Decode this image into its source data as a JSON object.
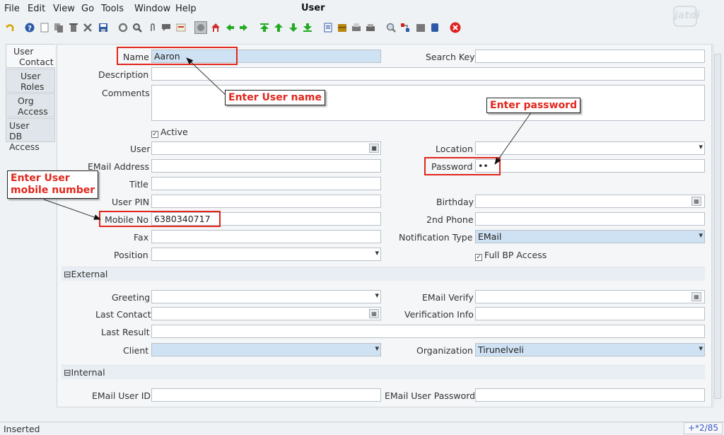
{
  "menu": [
    "File",
    "Edit",
    "View",
    "Go",
    "Tools",
    "Window",
    "Help"
  ],
  "window_title": "User",
  "logo_text": "jatdi",
  "toolbar_icons": [
    "undo-icon",
    "help-icon",
    "new-icon",
    "copy-icon",
    "delete-icon",
    "delete-selection-icon",
    "save-icon",
    "refresh-icon",
    "find-icon",
    "attachment-icon",
    "chat-icon",
    "history-icon",
    "home-icon",
    "parent-icon",
    "detail-icon",
    "first-record-icon",
    "previous-record-icon",
    "next-record-icon",
    "last-record-icon",
    "report-icon",
    "archive-icon",
    "print-preview-icon",
    "print-icon",
    "zoom-across-icon",
    "active-workflows-icon",
    "requests-icon",
    "product-info-icon",
    "close-window-icon"
  ],
  "tabs": [
    {
      "line1": "User",
      "line2": "Contact"
    },
    {
      "line1": "User",
      "line2": "Roles"
    },
    {
      "line1": "Org",
      "line2": "Access"
    },
    {
      "line1": "User",
      "line2": "DB Access"
    }
  ],
  "form": {
    "name_label": "Name",
    "name_value": "Aaron",
    "search_key_label": "Search Key",
    "search_key_value": "",
    "description_label": "Description",
    "description_value": "",
    "comments_label": "Comments",
    "comments_value": "",
    "active_label": "Active",
    "active_checked": true,
    "user_label": "User",
    "user_value": "",
    "location_label": "Location",
    "location_value": "",
    "email_label": "EMail Address",
    "email_value": "",
    "password_label": "Password",
    "password_value": "••",
    "title_label": "Title",
    "title_value": "",
    "user_pin_label": "User PIN",
    "user_pin_value": "",
    "birthday_label": "Birthday",
    "birthday_value": "",
    "mobile_label": "Mobile No",
    "mobile_value": "6380340717",
    "phone2_label": "2nd Phone",
    "phone2_value": "",
    "fax_label": "Fax",
    "fax_value": "",
    "notification_label": "Notification Type",
    "notification_value": "EMail",
    "position_label": "Position",
    "position_value": "",
    "full_bp_label": "Full BP Access",
    "full_bp_checked": true
  },
  "external": {
    "section_label": "External",
    "greeting_label": "Greeting",
    "greeting_value": "",
    "email_verify_label": "EMail Verify",
    "email_verify_value": "",
    "last_contact_label": "Last Contact",
    "last_contact_value": "",
    "verification_info_label": "Verification Info",
    "verification_info_value": "",
    "last_result_label": "Last Result",
    "last_result_value": "",
    "client_label": "Client",
    "client_value": "",
    "organization_label": "Organization",
    "organization_value": "Tirunelveli"
  },
  "internal": {
    "section_label": "Internal",
    "email_user_id_label": "EMail User ID",
    "email_user_id_value": "",
    "email_user_password_label": "EMail User Password",
    "email_user_password_value": ""
  },
  "annotations": {
    "name": "Enter User name",
    "password": "Enter password",
    "mobile_line1": "Enter User",
    "mobile_line2": "mobile number"
  },
  "status": {
    "text": "Inserted",
    "record_position": "+*2/85"
  },
  "colors": {
    "annotation_red": "#e2261c",
    "highlight_field": "#cfe2f3",
    "record_position_text": "#3d56c4"
  }
}
